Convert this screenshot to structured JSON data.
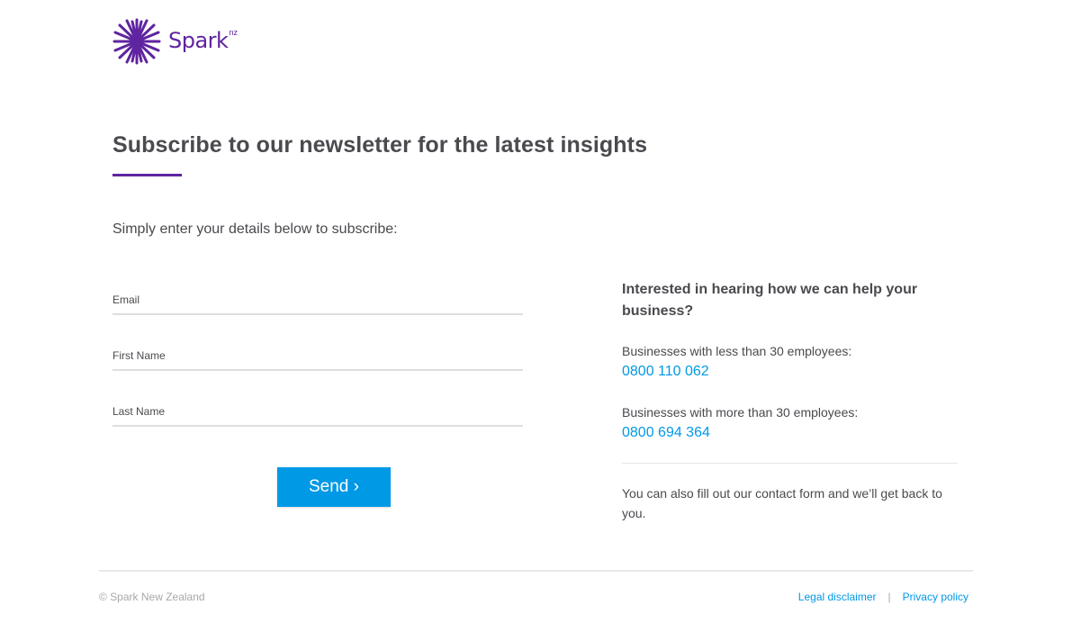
{
  "brand": {
    "name": "Spark",
    "superscript": "nz",
    "color": "#5f249f",
    "icon": "spark-star-logo-icon"
  },
  "page": {
    "title": "Subscribe to our newsletter for the latest insights",
    "intro": "Simply enter your details below to subscribe:"
  },
  "form": {
    "email_label": "Email",
    "first_name_label": "First Name",
    "last_name_label": "Last Name",
    "email_value": "",
    "first_name_value": "",
    "last_name_value": "",
    "send_label": "Send ›",
    "button_color": "#0099e6"
  },
  "contact": {
    "heading": "Interested in hearing how we can help your business?",
    "small_business_label": "Businesses with less than 30 employees:",
    "small_business_phone": "0800 110 062",
    "large_business_label": "Businesses with more than 30 employees:",
    "large_business_phone": "0800 694 364",
    "note": "You can also fill out our contact form and we’ll get back to you."
  },
  "footer": {
    "copyright": "© Spark New Zealand",
    "legal_label": "Legal disclaimer",
    "separator": "|",
    "privacy_label": "Privacy policy"
  }
}
